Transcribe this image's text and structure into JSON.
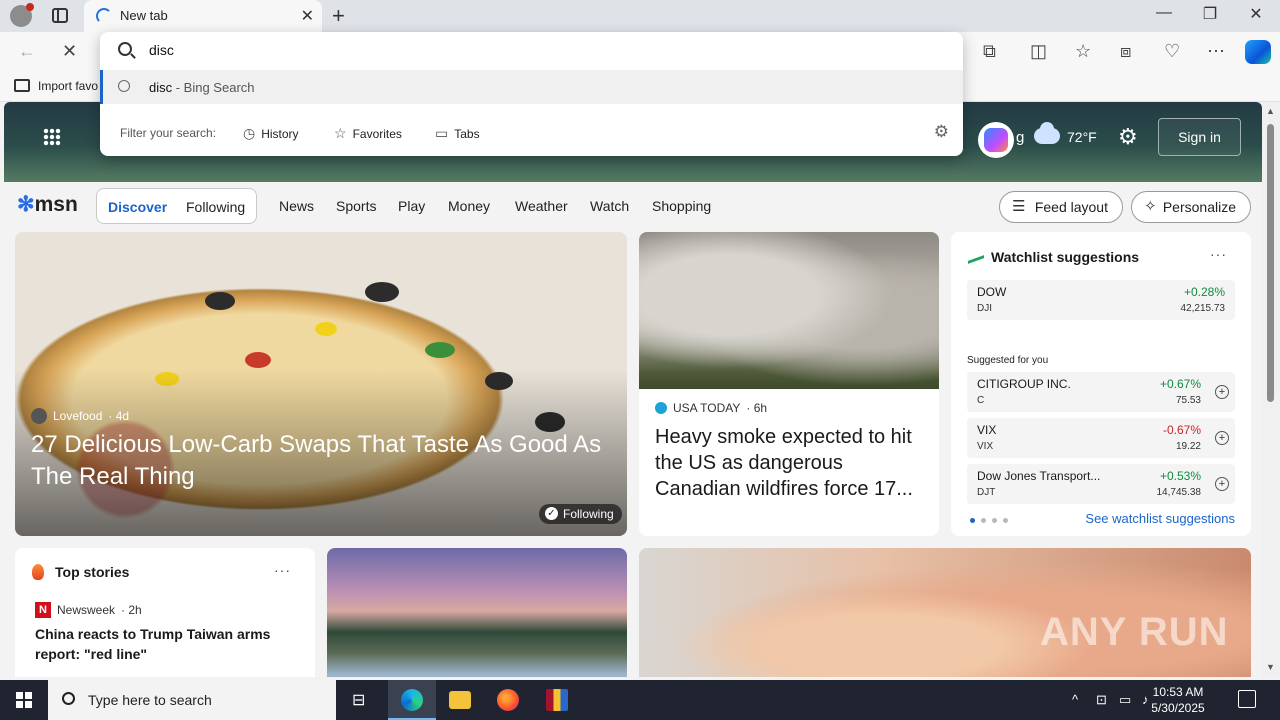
{
  "browser": {
    "tab_title": "New tab",
    "favorites_label": "Import favo"
  },
  "omnibox": {
    "query": "disc",
    "suggestion_query": "disc",
    "suggestion_suffix": " - Bing Search",
    "filter_label": "Filter your search:",
    "filters": [
      "History",
      "Favorites",
      "Tabs"
    ]
  },
  "hero": {
    "partial_text": "g",
    "temperature": "72°F",
    "sign_in": "Sign in"
  },
  "nav": {
    "logo": "msn",
    "segments": [
      "Discover",
      "Following"
    ],
    "links": [
      "News",
      "Sports",
      "Play",
      "Money",
      "Weather",
      "Watch",
      "Shopping"
    ],
    "feed_layout": "Feed layout",
    "personalize": "Personalize"
  },
  "cards": {
    "pizza": {
      "source": "Lovefood",
      "age": "· 4d",
      "title": "27 Delicious Low-Carb Swaps That Taste As Good As The Real Thing",
      "badge": "Following"
    },
    "smoke": {
      "source": "USA TODAY",
      "age": "· 6h",
      "title": "Heavy smoke expected to hit the US as dangerous Canadian wildfires force 17..."
    },
    "top_stories": {
      "title": "Top stories",
      "source": "Newsweek",
      "age": "· 2h",
      "headline": "China reacts to Trump Taiwan arms report: \"red line\""
    }
  },
  "watchlist": {
    "title": "Watchlist suggestions",
    "suggested_label": "Suggested for you",
    "link": "See watchlist suggestions",
    "main": {
      "name": "DOW",
      "ticker": "DJI",
      "change": "+0.28%",
      "price": "42,215.73"
    },
    "suggested": [
      {
        "name": "CITIGROUP INC.",
        "ticker": "C",
        "change": "+0.67%",
        "price": "75.53"
      },
      {
        "name": "VIX",
        "ticker": "VIX",
        "change": "-0.67%",
        "price": "19.22"
      },
      {
        "name": "Dow Jones Transport...",
        "ticker": "DJT",
        "change": "+0.53%",
        "price": "14,745.38"
      }
    ]
  },
  "watermark": "ANY RUN",
  "taskbar": {
    "search_placeholder": "Type here to search",
    "time": "10:53 AM",
    "date": "5/30/2025"
  },
  "colors": {
    "accent": "#1c64c8",
    "up": "#0f8a3e",
    "down": "#c4262e"
  }
}
